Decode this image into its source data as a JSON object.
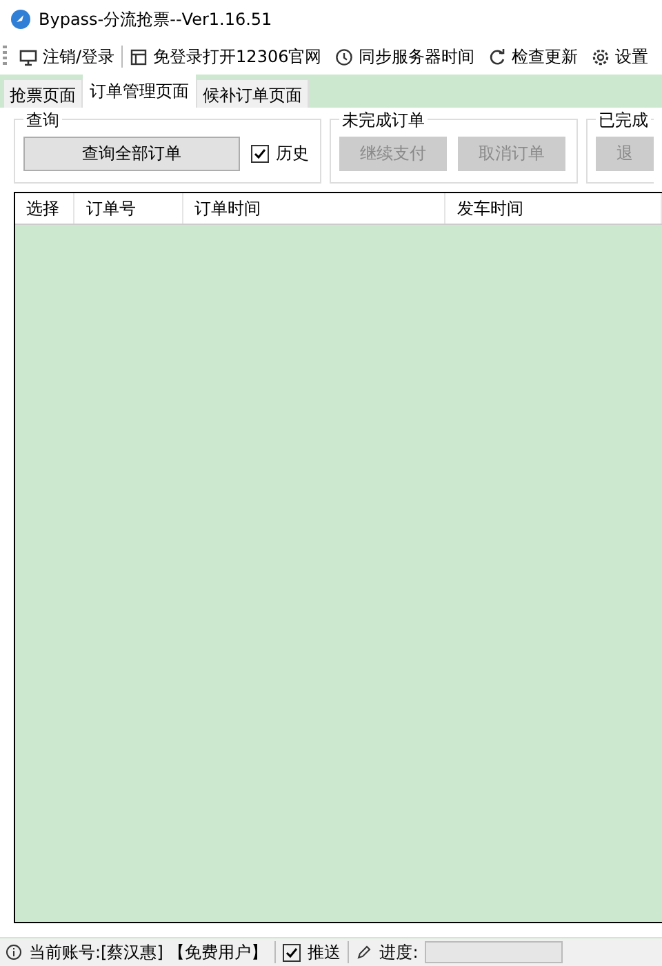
{
  "window": {
    "title": "Bypass-分流抢票--Ver1.16.51"
  },
  "toolbar": [
    {
      "kind": "monitor",
      "label": "注销/登录"
    },
    {
      "kind": "window",
      "label": "免登录打开12306官网"
    },
    {
      "kind": "clock",
      "label": "同步服务器时间"
    },
    {
      "kind": "refresh",
      "label": "检查更新"
    },
    {
      "kind": "gear",
      "label": "设置"
    }
  ],
  "tabs": [
    {
      "label": "抢票页面",
      "selected": false
    },
    {
      "label": "订单管理页面",
      "selected": true
    },
    {
      "label": "候补订单页面",
      "selected": false
    }
  ],
  "groups": [
    {
      "title": "查询",
      "items": [
        {
          "kind": "button",
          "label": "查询全部订单",
          "disabled": false
        },
        {
          "kind": "checkbox",
          "label": "历史",
          "checked": true
        }
      ]
    },
    {
      "title": "未完成订单",
      "items": [
        {
          "kind": "button",
          "label": "继续支付",
          "disabled": true
        },
        {
          "kind": "button",
          "label": "取消订单",
          "disabled": true
        }
      ]
    },
    {
      "title": "已完成",
      "items": [
        {
          "kind": "button",
          "label": "退",
          "disabled": true
        }
      ]
    }
  ],
  "table": {
    "columns": [
      "选择",
      "订单号",
      "订单时间",
      "发车时间"
    ]
  },
  "status_bar": {
    "account": "当前账号:[蔡汉惠] 【免费用户】",
    "push": {
      "label": "推送",
      "checked": true
    },
    "progress": {
      "label": "进度:",
      "level": 0
    }
  }
}
